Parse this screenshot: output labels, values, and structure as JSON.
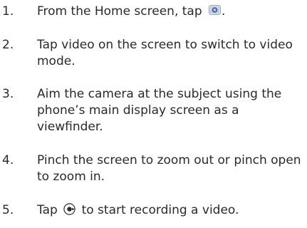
{
  "steps": [
    {
      "number": "1.",
      "text_before": "From the Home screen, tap",
      "icon": "camera-app-icon",
      "text_after": "."
    },
    {
      "number": "2.",
      "text": "Tap video on the screen to switch to video mode."
    },
    {
      "number": "3.",
      "text": "Aim the camera at the subject using the phone’s main display screen as a viewfinder."
    },
    {
      "number": "4.",
      "text": "Pinch the screen to zoom out or pinch open to zoom in."
    },
    {
      "number": "5.",
      "text_before": "Tap",
      "icon": "record-button-icon",
      "text_after": "to start recording a video."
    }
  ]
}
